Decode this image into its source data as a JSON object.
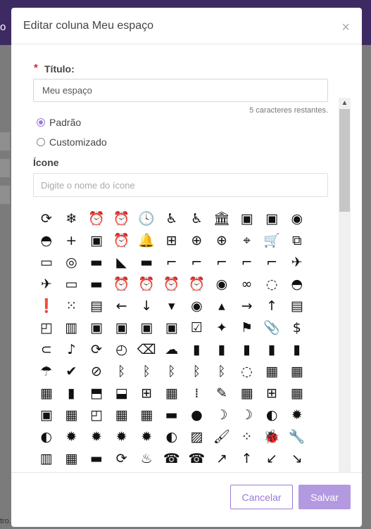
{
  "background": {
    "topbar_text": "o",
    "status_text": "tro."
  },
  "modal": {
    "title": "Editar coluna Meu espaço",
    "close_label": "×"
  },
  "form": {
    "required_mark": "*",
    "title_label": "Título:",
    "title_value": "Meu espaço",
    "remaining_text": "5 caracteres restantes.",
    "radio_options": [
      {
        "label": "Padrão",
        "checked": true
      },
      {
        "label": "Customizado",
        "checked": false
      }
    ],
    "icon_label": "Ícone",
    "icon_placeholder": "Digite o nome do ícone"
  },
  "icons": [
    {
      "name": "3d-rotation",
      "glyph": "⟳"
    },
    {
      "name": "ac-unit",
      "glyph": "❄"
    },
    {
      "name": "access-alarm",
      "glyph": "⏰"
    },
    {
      "name": "access-alarms",
      "glyph": "⏰"
    },
    {
      "name": "access-time",
      "glyph": "🕓"
    },
    {
      "name": "accessibility",
      "glyph": "♿"
    },
    {
      "name": "accessible",
      "glyph": "♿"
    },
    {
      "name": "account-balance",
      "glyph": "🏛"
    },
    {
      "name": "account-balance-wallet",
      "glyph": "▣"
    },
    {
      "name": "account-box",
      "glyph": "▣"
    },
    {
      "name": "account-circle",
      "glyph": "◉"
    },
    {
      "name": "adb",
      "glyph": "◓"
    },
    {
      "name": "add",
      "glyph": "+"
    },
    {
      "name": "add-a-photo",
      "glyph": "▣"
    },
    {
      "name": "add-alarm",
      "glyph": "⏰"
    },
    {
      "name": "add-alert",
      "glyph": "🔔"
    },
    {
      "name": "add-box",
      "glyph": "⊞"
    },
    {
      "name": "add-circle",
      "glyph": "⊕"
    },
    {
      "name": "add-circle-outline",
      "glyph": "⊕"
    },
    {
      "name": "add-location",
      "glyph": "⌖"
    },
    {
      "name": "add-shopping-cart",
      "glyph": "🛒"
    },
    {
      "name": "add-to-photos",
      "glyph": "⧉"
    },
    {
      "name": "add-to-queue",
      "glyph": "▭"
    },
    {
      "name": "adjust",
      "glyph": "◎"
    },
    {
      "name": "airline-seat-flat",
      "glyph": "▬"
    },
    {
      "name": "airline-seat-flat-angled",
      "glyph": "◣"
    },
    {
      "name": "airline-seat-individual-suite",
      "glyph": "▬"
    },
    {
      "name": "airline-seat-legroom-extra",
      "glyph": "⌐"
    },
    {
      "name": "airline-seat-legroom-normal",
      "glyph": "⌐"
    },
    {
      "name": "airline-seat-legroom-reduced",
      "glyph": "⌐"
    },
    {
      "name": "airline-seat-recline-extra",
      "glyph": "⌐"
    },
    {
      "name": "airline-seat-recline-normal",
      "glyph": "⌐"
    },
    {
      "name": "airplanemode-active",
      "glyph": "✈"
    },
    {
      "name": "airplanemode-inactive",
      "glyph": "✈"
    },
    {
      "name": "airplay",
      "glyph": "▭"
    },
    {
      "name": "airport-shuttle",
      "glyph": "▬"
    },
    {
      "name": "alarm",
      "glyph": "⏰"
    },
    {
      "name": "alarm-add",
      "glyph": "⏰"
    },
    {
      "name": "alarm-off",
      "glyph": "⏰"
    },
    {
      "name": "alarm-on",
      "glyph": "⏰"
    },
    {
      "name": "album",
      "glyph": "◉"
    },
    {
      "name": "all-inclusive",
      "glyph": "∞"
    },
    {
      "name": "all-out",
      "glyph": "◌"
    },
    {
      "name": "android",
      "glyph": "◓"
    },
    {
      "name": "announcement",
      "glyph": "❗"
    },
    {
      "name": "apps",
      "glyph": "⁙"
    },
    {
      "name": "archive",
      "glyph": "▤"
    },
    {
      "name": "arrow-back",
      "glyph": "←"
    },
    {
      "name": "arrow-downward",
      "glyph": "↓"
    },
    {
      "name": "arrow-drop-down",
      "glyph": "▾"
    },
    {
      "name": "arrow-drop-down-circle",
      "glyph": "◉"
    },
    {
      "name": "arrow-drop-up",
      "glyph": "▴"
    },
    {
      "name": "arrow-forward",
      "glyph": "→"
    },
    {
      "name": "arrow-upward",
      "glyph": "↑"
    },
    {
      "name": "art-track",
      "glyph": "▤"
    },
    {
      "name": "aspect-ratio",
      "glyph": "◰"
    },
    {
      "name": "assessment",
      "glyph": "▥"
    },
    {
      "name": "assignment",
      "glyph": "▣"
    },
    {
      "name": "assignment-late",
      "glyph": "▣"
    },
    {
      "name": "assignment-return",
      "glyph": "▣"
    },
    {
      "name": "assignment-returned",
      "glyph": "▣"
    },
    {
      "name": "assignment-turned-in",
      "glyph": "☑"
    },
    {
      "name": "assistant",
      "glyph": "✦"
    },
    {
      "name": "assistant-photo",
      "glyph": "⚑"
    },
    {
      "name": "attach-file",
      "glyph": "📎"
    },
    {
      "name": "attach-money",
      "glyph": "$"
    },
    {
      "name": "attachment",
      "glyph": "⊂"
    },
    {
      "name": "audiotrack",
      "glyph": "♪"
    },
    {
      "name": "autorenew",
      "glyph": "⟳"
    },
    {
      "name": "av-timer",
      "glyph": "◴"
    },
    {
      "name": "backspace",
      "glyph": "⌫"
    },
    {
      "name": "backup",
      "glyph": "☁"
    },
    {
      "name": "battery-alert",
      "glyph": "▮"
    },
    {
      "name": "battery-charging-full",
      "glyph": "▮"
    },
    {
      "name": "battery-full",
      "glyph": "▮"
    },
    {
      "name": "battery-std",
      "glyph": "▮"
    },
    {
      "name": "battery-unknown",
      "glyph": "▮"
    },
    {
      "name": "beach-access",
      "glyph": "☂"
    },
    {
      "name": "beenhere",
      "glyph": "✔"
    },
    {
      "name": "block",
      "glyph": "⊘"
    },
    {
      "name": "bluetooth",
      "glyph": "ᛒ"
    },
    {
      "name": "bluetooth-audio",
      "glyph": "ᛒ"
    },
    {
      "name": "bluetooth-connected",
      "glyph": "ᛒ"
    },
    {
      "name": "bluetooth-disabled",
      "glyph": "ᛒ"
    },
    {
      "name": "bluetooth-searching",
      "glyph": "ᛒ"
    },
    {
      "name": "blur-circular",
      "glyph": "◌"
    },
    {
      "name": "blur-linear",
      "glyph": "▦"
    },
    {
      "name": "blur-off",
      "glyph": "▦"
    },
    {
      "name": "blur-on",
      "glyph": "▦"
    },
    {
      "name": "book",
      "glyph": "▮"
    },
    {
      "name": "bookmark",
      "glyph": "⬒"
    },
    {
      "name": "bookmark-border",
      "glyph": "⬓"
    },
    {
      "name": "border-all",
      "glyph": "⊞"
    },
    {
      "name": "border-bottom",
      "glyph": "▦"
    },
    {
      "name": "border-clear",
      "glyph": "⁞"
    },
    {
      "name": "border-color",
      "glyph": "✎"
    },
    {
      "name": "border-horizontal",
      "glyph": "▦"
    },
    {
      "name": "border-inner",
      "glyph": "⊞"
    },
    {
      "name": "border-left",
      "glyph": "▦"
    },
    {
      "name": "border-outer",
      "glyph": "▣"
    },
    {
      "name": "border-right",
      "glyph": "▦"
    },
    {
      "name": "border-style",
      "glyph": "◰"
    },
    {
      "name": "border-top",
      "glyph": "▦"
    },
    {
      "name": "border-vertical",
      "glyph": "▦"
    },
    {
      "name": "branding-watermark",
      "glyph": "▬"
    },
    {
      "name": "brightness-1",
      "glyph": "●"
    },
    {
      "name": "brightness-2",
      "glyph": "☽"
    },
    {
      "name": "brightness-3",
      "glyph": "☽"
    },
    {
      "name": "brightness-4",
      "glyph": "◐"
    },
    {
      "name": "brightness-5",
      "glyph": "✹"
    },
    {
      "name": "brightness-6",
      "glyph": "◐"
    },
    {
      "name": "brightness-7",
      "glyph": "✹"
    },
    {
      "name": "brightness-auto",
      "glyph": "✹"
    },
    {
      "name": "brightness-high",
      "glyph": "✹"
    },
    {
      "name": "brightness-low",
      "glyph": "✹"
    },
    {
      "name": "brightness-medium",
      "glyph": "◐"
    },
    {
      "name": "broken-image",
      "glyph": "▨"
    },
    {
      "name": "brush",
      "glyph": "🖌"
    },
    {
      "name": "bubble-chart",
      "glyph": "⁘"
    },
    {
      "name": "bug-report",
      "glyph": "🐞"
    },
    {
      "name": "build",
      "glyph": "🔧"
    },
    {
      "name": "burst-mode",
      "glyph": "▥"
    },
    {
      "name": "business",
      "glyph": "▦"
    },
    {
      "name": "business-center",
      "glyph": "▬"
    },
    {
      "name": "cached",
      "glyph": "⟳"
    },
    {
      "name": "cake",
      "glyph": "♨"
    },
    {
      "name": "call",
      "glyph": "☎"
    },
    {
      "name": "call-end",
      "glyph": "☎"
    },
    {
      "name": "call-made",
      "glyph": "↗"
    },
    {
      "name": "call-merge",
      "glyph": "↑"
    },
    {
      "name": "call-missed",
      "glyph": "↙"
    },
    {
      "name": "call-missed-outgoing",
      "glyph": "↘"
    }
  ],
  "scrollbar": {
    "up_arrow": "▲",
    "down_arrow": "▼"
  },
  "footer": {
    "cancel_label": "Cancelar",
    "save_label": "Salvar"
  },
  "colors": {
    "accent": "#9a7ad6",
    "accent_light": "#b39ae0",
    "topbar": "#3e2a63",
    "required": "#d9233a"
  }
}
